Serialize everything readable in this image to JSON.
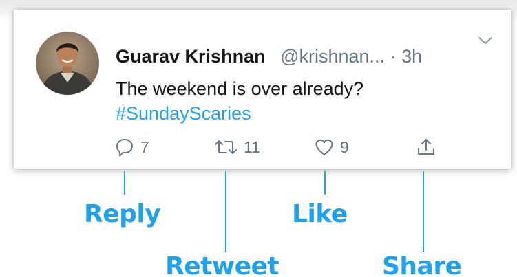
{
  "tweet": {
    "author_name": "Guarav Krishnan",
    "author_handle": "@krishnan...",
    "separator": "·",
    "age": "3h",
    "text": "The weekend is over already?",
    "hashtag": "#SundayScaries"
  },
  "actions": {
    "reply_count": "7",
    "retweet_count": "11",
    "like_count": "9"
  },
  "callouts": {
    "reply": "Reply",
    "retweet": "Retweet",
    "like": "Like",
    "share": "Share"
  },
  "colors": {
    "accent": "#1da1f2",
    "text_primary": "#14171a",
    "text_secondary": "#657786"
  },
  "icons": [
    "chevron-down-icon",
    "reply-icon",
    "retweet-icon",
    "like-icon",
    "share-icon"
  ]
}
